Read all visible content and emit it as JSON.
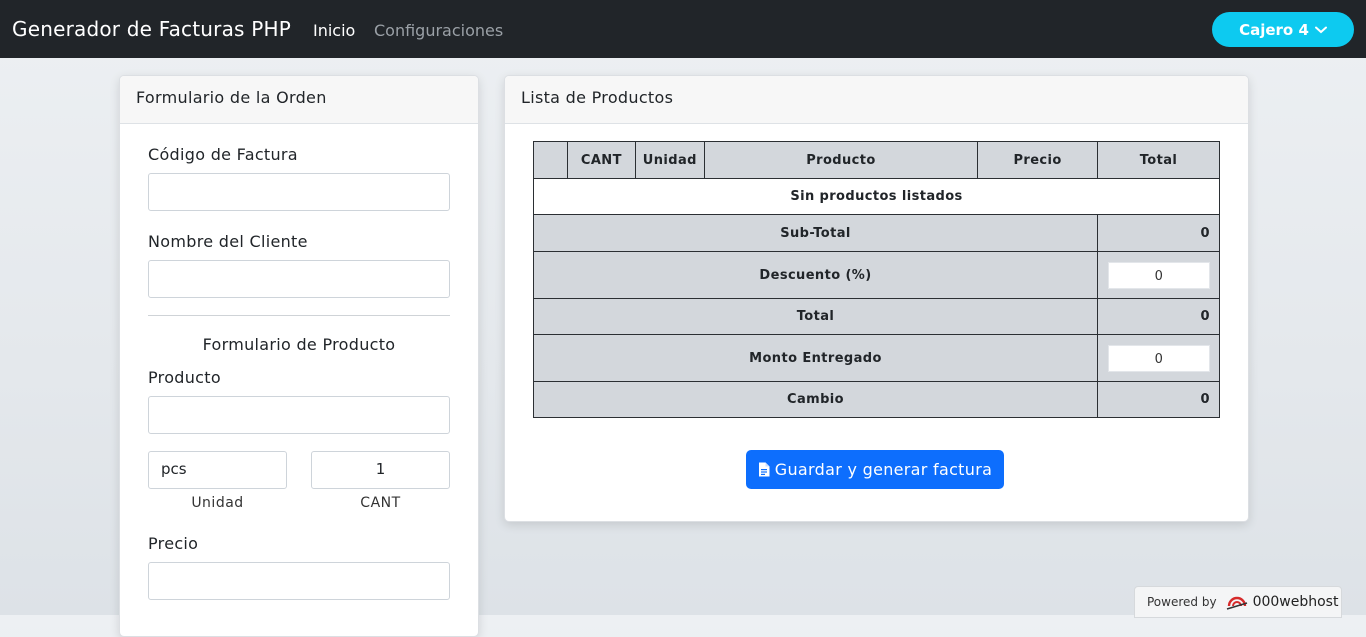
{
  "navbar": {
    "brand": "Generador de Facturas PHP",
    "links": [
      {
        "label": "Inicio",
        "active": true
      },
      {
        "label": "Configuraciones",
        "active": false
      }
    ],
    "user_button": "Cajero 4"
  },
  "order_form": {
    "title": "Formulario de la Orden",
    "invoice_code_label": "Código de Factura",
    "invoice_code_value": "",
    "client_name_label": "Nombre del Cliente",
    "client_name_value": "",
    "product_form_title": "Formulario de Producto",
    "product_label": "Producto",
    "product_value": "",
    "unit_value": "pcs",
    "unit_label": "Unidad",
    "qty_value": "1",
    "qty_label": "CANT",
    "price_label": "Precio",
    "price_value": ""
  },
  "product_list": {
    "title": "Lista de Productos",
    "columns": [
      "",
      "CANT",
      "Unidad",
      "Producto",
      "Precio",
      "Total"
    ],
    "empty_message": "Sin productos listados",
    "summary": {
      "subtotal_label": "Sub-Total",
      "subtotal_value": "0",
      "discount_label": "Descuento (%)",
      "discount_value": "0",
      "total_label": "Total",
      "total_value": "0",
      "amount_given_label": "Monto Entregado",
      "amount_given_value": "0",
      "change_label": "Cambio",
      "change_value": "0"
    },
    "save_button": "Guardar y generar factura"
  },
  "footer": {
    "powered_by": "Powered by",
    "host": "000webhost"
  },
  "colors": {
    "navbar": "#212529",
    "user_button": "#0dcaf0",
    "primary_button": "#0d6efd",
    "table_header": "#d3d7dc"
  }
}
